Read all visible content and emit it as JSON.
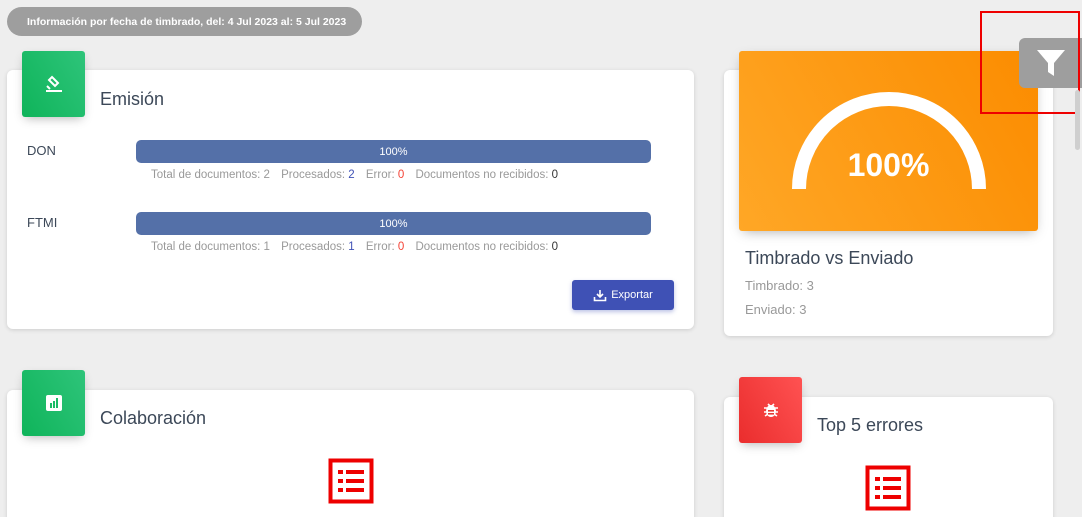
{
  "header": {
    "date_range": "Información por fecha de timbrado, del: 4 Jul 2023 al: 5 Jul 2023"
  },
  "emision": {
    "title": "Emisión",
    "icon": "stamp-icon",
    "rows": [
      {
        "label": "DON",
        "progress": 100,
        "progress_text": "100%",
        "total_label": "Total de documentos:",
        "total_value": "2",
        "procesados_label": "Procesados:",
        "procesados_value": "2",
        "error_label": "Error:",
        "error_value": "0",
        "no_recibidos_label": "Documentos no recibidos:",
        "no_recibidos_value": "0"
      },
      {
        "label": "FTMI",
        "progress": 100,
        "progress_text": "100%",
        "total_label": "Total de documentos:",
        "total_value": "1",
        "procesados_label": "Procesados:",
        "procesados_value": "1",
        "error_label": "Error:",
        "error_value": "0",
        "no_recibidos_label": "Documentos no recibidos:",
        "no_recibidos_value": "0"
      }
    ],
    "export_label": "Exportar"
  },
  "timbrado": {
    "gauge_value": 100,
    "gauge_text": "100%",
    "title": "Timbrado vs Enviado",
    "timbrado_text": "Timbrado: 3",
    "enviado_text": "Enviado: 3"
  },
  "colaboracion": {
    "title": "Colaboración",
    "icon": "bar-chart-icon"
  },
  "errores": {
    "title": "Top 5 errores",
    "icon": "bug-icon"
  },
  "colors": {
    "green": "#0fb45a",
    "orange": "#fb8c00",
    "red": "#e53935",
    "progress": "#5470a8",
    "button": "#3f51b5"
  }
}
